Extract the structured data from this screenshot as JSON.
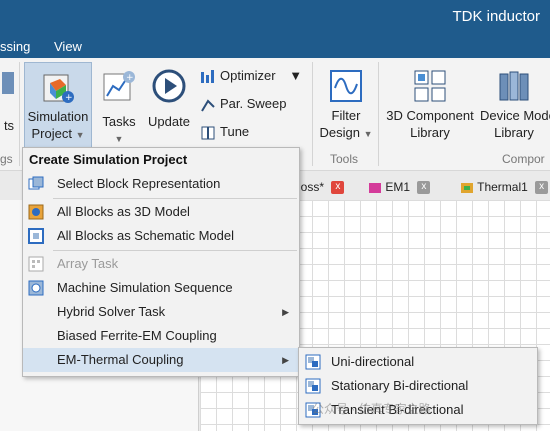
{
  "window": {
    "title": "TDK inductor"
  },
  "menubar": {
    "items": [
      "ssing",
      "View"
    ]
  },
  "ribbon": {
    "partial_left_label": "ts",
    "partial_group_label": "gs",
    "simulation_project": {
      "line1": "Simulation",
      "line2": "Project"
    },
    "tasks": {
      "label": "Tasks"
    },
    "update": {
      "label": "Update"
    },
    "optimizer": {
      "label": "Optimizer"
    },
    "par_sweep": {
      "label": "Par. Sweep"
    },
    "tune": {
      "label": "Tune"
    },
    "filter_design": {
      "line1": "Filter",
      "line2": "Design"
    },
    "tools_group": "Tools",
    "component_library": {
      "line1": "3D Component",
      "line2": "Library"
    },
    "device_model_library": {
      "line1": "Device Mode",
      "line2": "Library"
    },
    "components_group": "Compor"
  },
  "tabs": [
    {
      "label": "loss*",
      "close": "x"
    },
    {
      "label": "EM1",
      "close": "x"
    },
    {
      "label": "Thermal1",
      "close": "x"
    }
  ],
  "dropdown": {
    "header": "Create Simulation Project",
    "items": [
      {
        "label": "Select Block Representation",
        "icon": "block-representation-icon"
      },
      {
        "label": "All Blocks as 3D Model",
        "icon": "3d-model-icon"
      },
      {
        "label": "All Blocks as Schematic Model",
        "icon": "schematic-model-icon"
      },
      {
        "label": "Array Task",
        "icon": "array-task-icon",
        "disabled": true
      },
      {
        "label": "Machine Simulation Sequence",
        "icon": "machine-sequence-icon"
      },
      {
        "label": "Hybrid Solver Task",
        "submenu": true
      },
      {
        "label": "Biased Ferrite-EM Coupling"
      },
      {
        "label": "EM-Thermal Coupling",
        "submenu": true,
        "highlighted": true
      }
    ]
  },
  "submenu": {
    "items": [
      {
        "label": "Uni-directional",
        "icon": "coupling-icon"
      },
      {
        "label": "Stationary Bi-directional",
        "icon": "coupling-icon"
      },
      {
        "label": "Transient Bi-directional",
        "icon": "coupling-icon"
      }
    ]
  },
  "watermark": "公众号 · 仿真专家之路",
  "colors": {
    "title_bar": "#1f5b8c",
    "menu_highlight": "#d5e3f1",
    "tab_close_red": "#e0463c",
    "tab_close_gray": "#9a9a9a"
  }
}
